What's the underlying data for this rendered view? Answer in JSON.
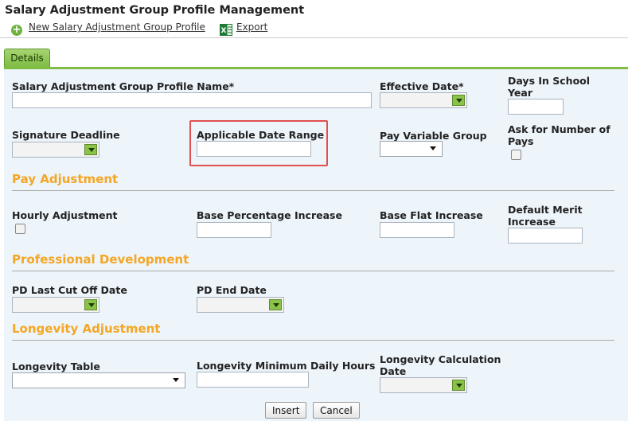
{
  "page": {
    "title": "Salary Adjustment Group Profile Management"
  },
  "toolbar": {
    "new_label": "New Salary Adjustment Group Profile",
    "export_label": "Export",
    "new_icon": "plus-circle-icon",
    "export_icon": "excel-icon"
  },
  "tabs": [
    {
      "label": "Details",
      "active": true
    }
  ],
  "form": {
    "profile_name_label": "Salary Adjustment Group Profile Name*",
    "profile_name_value": "",
    "effective_date_label": "Effective Date*",
    "effective_date_value": "",
    "days_in_school_year_label_1": "Days In School",
    "days_in_school_year_label_2": "Year",
    "days_in_school_year_value": "",
    "signature_deadline_label": "Signature Deadline",
    "signature_deadline_value": "",
    "applicable_date_range_label": "Applicable Date Range",
    "applicable_date_range_value": "",
    "pay_variable_group_label": "Pay Variable Group",
    "pay_variable_group_value": "",
    "ask_number_of_pays_label_1": "Ask for Number of",
    "ask_number_of_pays_label_2": "Pays",
    "ask_number_of_pays_checked": false
  },
  "pay_adjustment": {
    "section_title": "Pay Adjustment",
    "hourly_adjustment_label": "Hourly Adjustment",
    "hourly_adjustment_checked": false,
    "base_percentage_label": "Base Percentage Increase",
    "base_percentage_value": "",
    "base_flat_label": "Base Flat Increase",
    "base_flat_value": "",
    "default_merit_label_1": "Default Merit",
    "default_merit_label_2": "Increase",
    "default_merit_value": ""
  },
  "professional_development": {
    "section_title": "Professional Development",
    "pd_last_cutoff_label": "PD Last Cut Off Date",
    "pd_last_cutoff_value": "",
    "pd_end_date_label": "PD End Date",
    "pd_end_date_value": ""
  },
  "longevity": {
    "section_title": "Longevity Adjustment",
    "table_label": "Longevity Table",
    "table_value": "",
    "min_daily_hours_label": "Longevity Minimum Daily Hours",
    "min_daily_hours_value": "",
    "calc_date_label_1": "Longevity Calculation",
    "calc_date_label_2": "Date",
    "calc_date_value": ""
  },
  "actions": {
    "insert_label": "Insert",
    "cancel_label": "Cancel"
  },
  "colors": {
    "section_heading": "#f5a623",
    "tab_green": "#7fbd44",
    "highlight_border": "#e05050",
    "panel_background": "#edf4fa"
  }
}
